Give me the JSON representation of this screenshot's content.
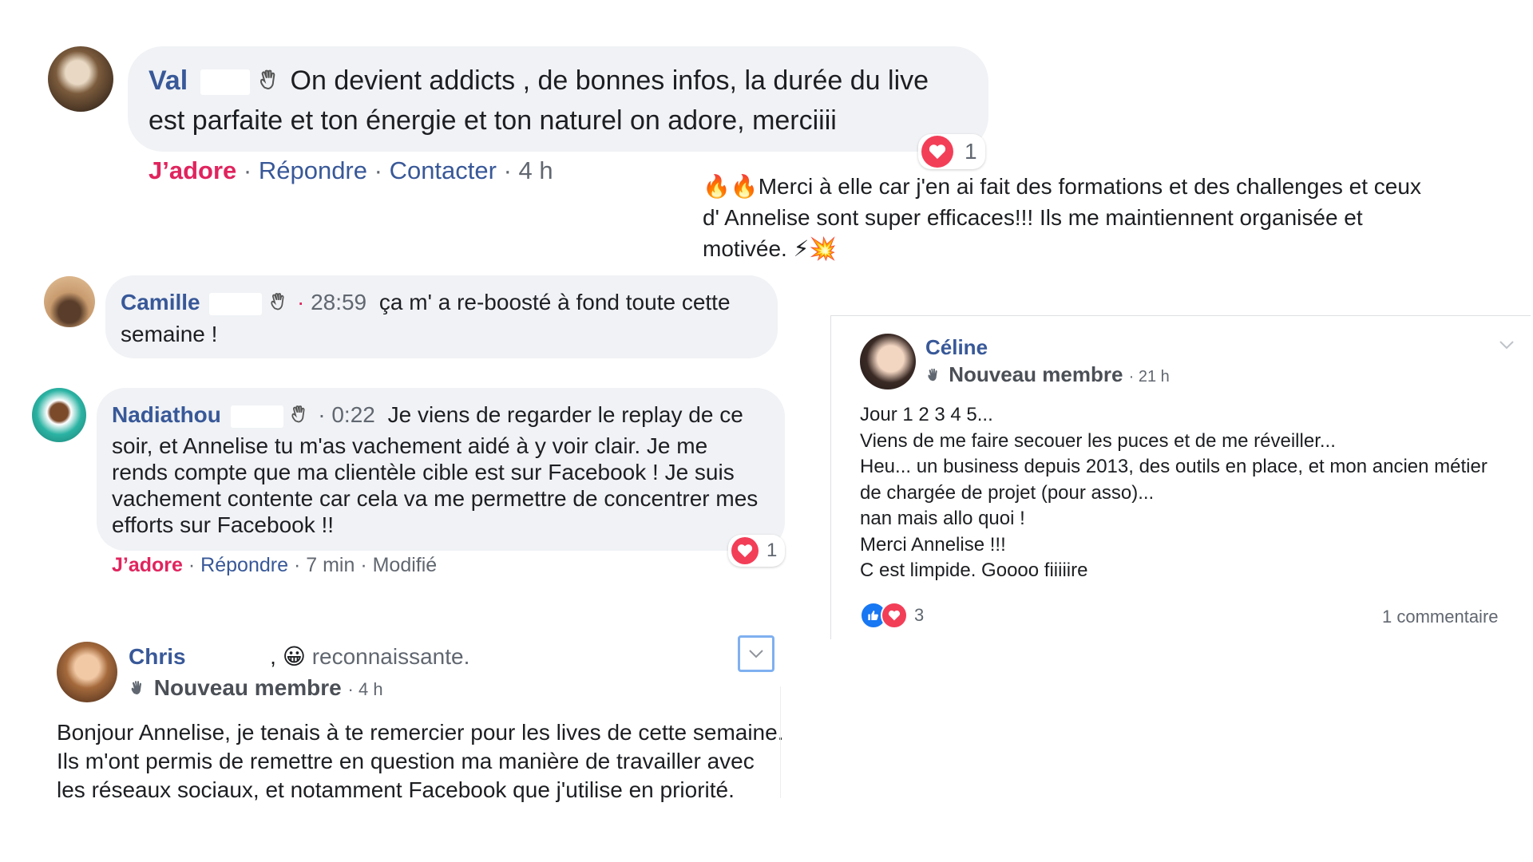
{
  "comments": {
    "val": {
      "name": "Val",
      "text_line1": "On devient addicts , de bonnes infos, la durée du live",
      "text_line2": "est parfaite et ton énergie et ton naturel on adore, merciiii",
      "action_love": "J’adore",
      "action_reply": "Répondre",
      "action_contact": "Contacter",
      "time": "4 h",
      "reaction_count": "1"
    },
    "camille": {
      "name": "Camille",
      "timestamp": "28:59",
      "text_line1": "ça m' a re-boosté à fond toute cette",
      "text_line2": "semaine !"
    },
    "nadiathou": {
      "name": "Nadiathou",
      "timestamp": "0:22",
      "text_line1": "Je viens de regarder le replay de ce",
      "lines": [
        "soir, et Annelise tu m'as vachement aidé à y voir clair. Je me",
        "rends compte que ma clientèle cible est sur Facebook ! Je suis",
        "vachement contente car cela va me permettre de concentrer mes",
        "efforts sur Facebook !!"
      ],
      "action_love": "J’adore",
      "action_reply": "Répondre",
      "time": "7 min",
      "edited": "Modifié",
      "reaction_count": "1"
    },
    "chris": {
      "name": "Chris",
      "feeling": "reconnaissante.",
      "badge": "Nouveau membre",
      "time": "4 h",
      "lines": [
        "Bonjour Annelise, je tenais à te remercier pour les lives de cette semaine.",
        "Ils m'ont permis de remettre en question ma manière de travailler avec",
        "les réseaux sociaux, et notamment Facebook que j'utilise en priorité."
      ]
    }
  },
  "floating_text": {
    "line1": "Merci à elle car j'en ai fait des formations et des challenges et ceux",
    "line2": "d' Annelise sont super efficaces!!! Ils me maintiennent organisée et",
    "line3": "motivée."
  },
  "post_celine": {
    "name": "Céline",
    "badge": "Nouveau membre",
    "time": "21 h",
    "lines": [
      "Jour 1 2 3 4 5...",
      "Viens de me faire secouer les puces et de me réveiller...",
      "Heu... un business depuis 2013, des outils en place, et mon ancien métier",
      "de chargée de projet (pour asso)...",
      "nan mais allo quoi !",
      "Merci Annelise !!!",
      "C est limpide. Goooo fiiiiire"
    ],
    "reaction_count": "3",
    "comments_count": "1 commentaire"
  },
  "colors": {
    "link": "#385898",
    "love": "#e0245e",
    "bubble": "#f0f2f5",
    "like": "#1877f2"
  }
}
